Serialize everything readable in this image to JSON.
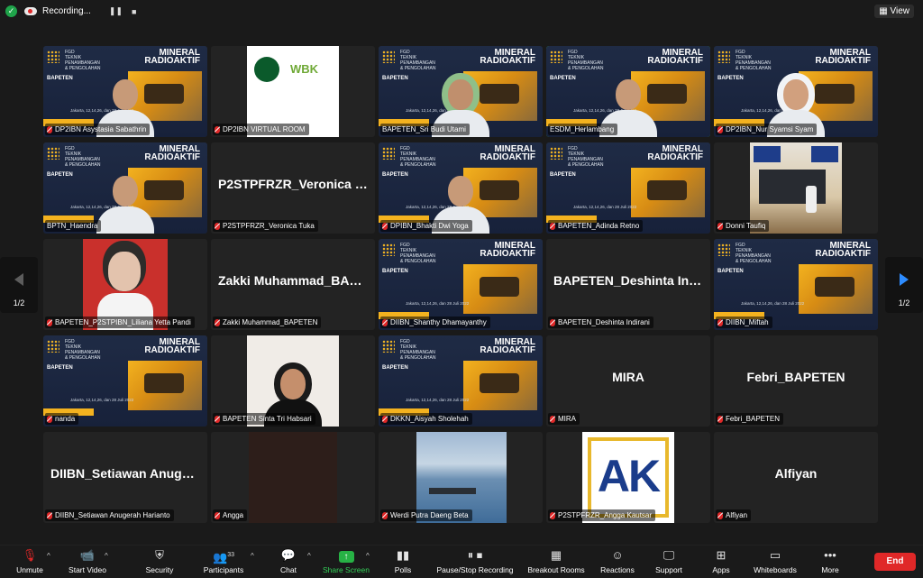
{
  "topbar": {
    "recording_label": "Recording...",
    "view_label": "View",
    "pause_icon": "pause-icon",
    "stop_icon": "stop-icon"
  },
  "slide": {
    "title_line1": "MINERAL",
    "title_line2": "RADIOAKTIF",
    "sub1": "FGD",
    "sub2": "TEKNIK",
    "sub3": "PENAMBANGAN",
    "sub4": "& PENGOLAHAN",
    "org": "BAPETEN",
    "date": "Jakarta, 12,14,26, dan 28 Juli 2022"
  },
  "tiles": [
    {
      "name": "DP2IBN Asystasia Sabathrin",
      "muted": true
    },
    {
      "name": "DP2IBN VIRTUAL ROOM",
      "muted": true
    },
    {
      "name": "BAPETEN_Sri Budi Utami",
      "muted": false
    },
    {
      "name": "ESDM_Herlambang",
      "muted": false
    },
    {
      "name": "DP2IBN_Nur Syamsi Syam",
      "muted": true
    },
    {
      "name": "BPTN_Haendra",
      "muted": false
    },
    {
      "name": "P2STPFRZR_Veronica Tuka",
      "muted": true,
      "big": "P2STPFRZR_Veronica T..."
    },
    {
      "name": "DPIBN_Bhakti Dwi Yoga",
      "muted": true
    },
    {
      "name": "BAPETEN_Adinda Retno",
      "muted": true
    },
    {
      "name": "Donni Taufiq",
      "muted": true
    },
    {
      "name": "BAPETEN_P2STPIBN_Liliana Yetta Pandi",
      "muted": true
    },
    {
      "name": "Zakki Muhammad_BAPETEN",
      "muted": true,
      "big": "Zakki Muhammad_BAPE..."
    },
    {
      "name": "DIIBN_Shanthy Dhamayanthy",
      "muted": true
    },
    {
      "name": "BAPETEN_Deshinta Indirani",
      "muted": true,
      "big": "BAPETEN_Deshinta Indir..."
    },
    {
      "name": "DIIBN_Miftah",
      "muted": true
    },
    {
      "name": "nanda",
      "muted": true
    },
    {
      "name": "BAPETEN Sinta Tri Habsari",
      "muted": true
    },
    {
      "name": "DKKN_Aisyah Sholehah",
      "muted": true
    },
    {
      "name": "MIRA",
      "muted": true,
      "big": "MIRA"
    },
    {
      "name": "Febri_BAPETEN",
      "muted": true,
      "big": "Febri_BAPETEN"
    },
    {
      "name": "DIIBN_Setiawan Anugerah Harianto",
      "muted": true,
      "big": "DIIBN_Setiawan Anuger..."
    },
    {
      "name": "Angga",
      "muted": true
    },
    {
      "name": "Werdi Putra Daeng Beta",
      "muted": true
    },
    {
      "name": "P2STPFRZR_Angga Kautsar",
      "muted": true
    },
    {
      "name": "Alfiyan",
      "muted": true,
      "big": "Alfiyan"
    }
  ],
  "pager": {
    "left": "1/2",
    "right": "1/2"
  },
  "ak_logo_text": "AK",
  "toolbar": {
    "unmute": "Unmute",
    "start_video": "Start Video",
    "security": "Security",
    "participants": "Participants",
    "participants_count": "33",
    "chat": "Chat",
    "share_screen": "Share Screen",
    "polls": "Polls",
    "pause_stop": "Pause/Stop Recording",
    "breakout": "Breakout Rooms",
    "reactions": "Reactions",
    "support": "Support",
    "apps": "Apps",
    "whiteboards": "Whiteboards",
    "more": "More",
    "end": "End"
  },
  "colors": {
    "accent_green": "#33c24d",
    "mute_red": "#e02828",
    "share_green": "#27b245",
    "end_red": "#e02828"
  }
}
